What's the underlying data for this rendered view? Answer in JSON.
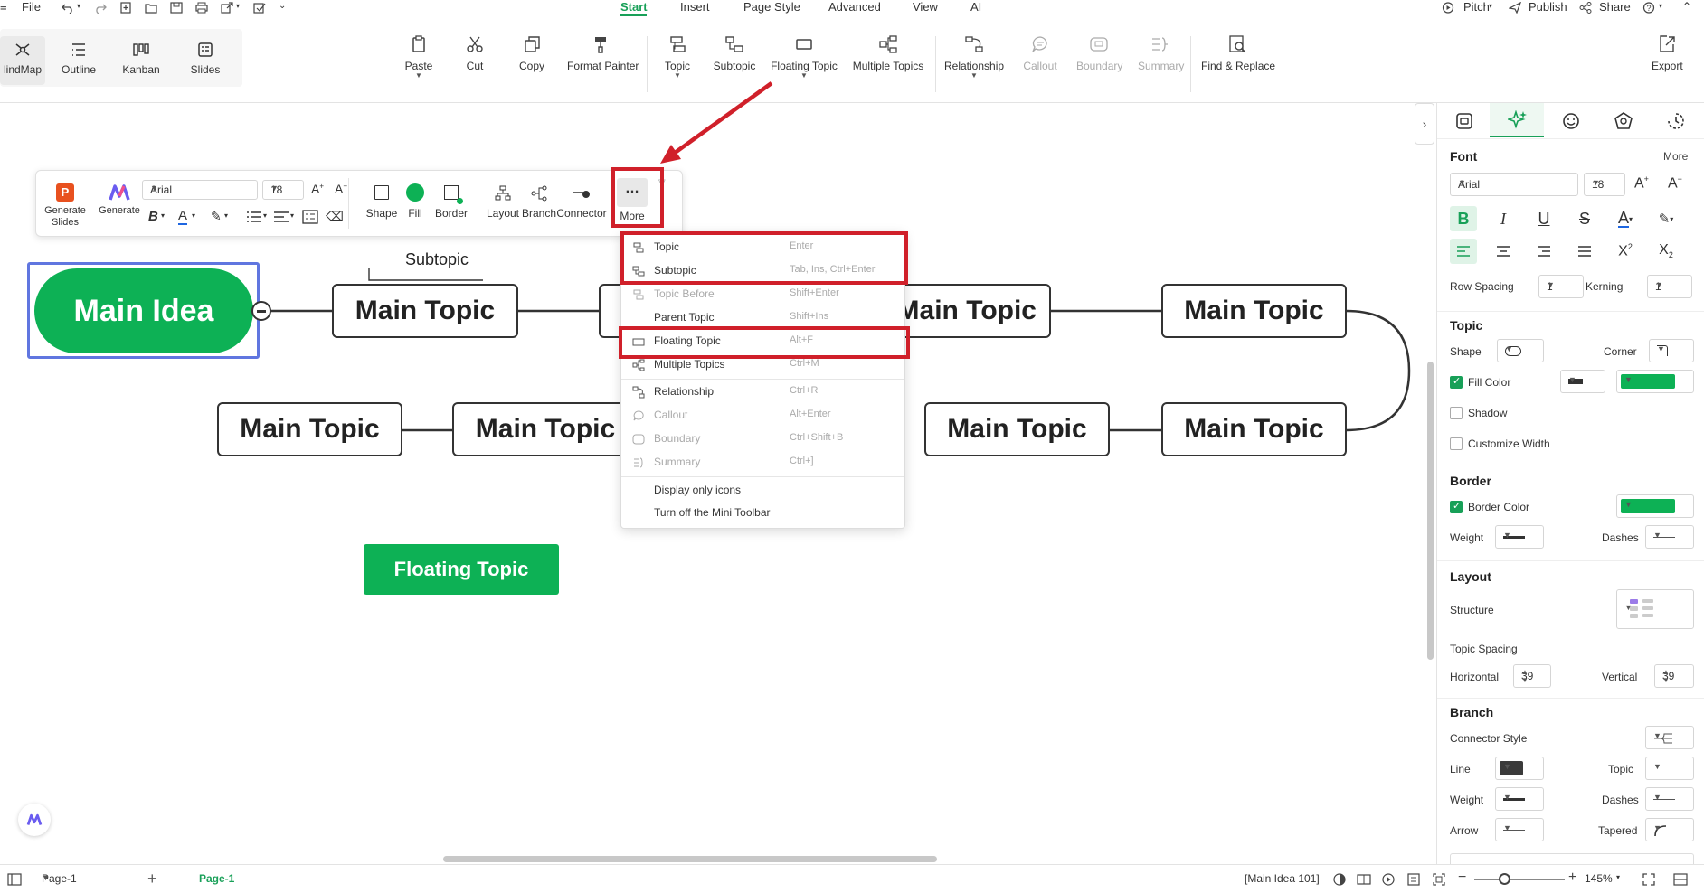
{
  "menubar": {
    "file": "File",
    "tabs": [
      "Start",
      "Insert",
      "Page Style",
      "Advanced",
      "View",
      "AI"
    ],
    "right": {
      "pitch": "Pitch",
      "publish": "Publish",
      "share": "Share"
    }
  },
  "views": [
    "lindMap",
    "Outline",
    "Kanban",
    "Slides"
  ],
  "ribbon": {
    "paste": "Paste",
    "cut": "Cut",
    "copy": "Copy",
    "format_painter": "Format Painter",
    "topic": "Topic",
    "subtopic": "Subtopic",
    "floating_topic": "Floating Topic",
    "multiple_topics": "Multiple Topics",
    "relationship": "Relationship",
    "callout": "Callout",
    "boundary": "Boundary",
    "summary": "Summary",
    "find_replace": "Find & Replace",
    "export": "Export"
  },
  "canvas": {
    "main_idea": "Main Idea",
    "subtopic_label": "Subtopic",
    "main_topic": "Main Topic",
    "floating_topic": "Floating Topic",
    "accent": "#0db155",
    "selection": "#6076e0",
    "annotation": "#d0202a"
  },
  "mini_toolbar": {
    "generate_slides": "Generate Slides",
    "generate": "Generate",
    "font": "Arial",
    "size": "18",
    "shape": "Shape",
    "fill": "Fill",
    "border": "Border",
    "layout": "Layout",
    "branch": "Branch",
    "connector": "Connector",
    "more": "More"
  },
  "more_menu": [
    {
      "label": "Topic",
      "shortcut": "Enter",
      "disabled": false
    },
    {
      "label": "Subtopic",
      "shortcut": "Tab, Ins, Ctrl+Enter",
      "disabled": false
    },
    {
      "label": "Topic Before",
      "shortcut": "Shift+Enter",
      "disabled": true
    },
    {
      "label": "Parent Topic",
      "shortcut": "Shift+Ins",
      "disabled": false
    },
    {
      "label": "Floating Topic",
      "shortcut": "Alt+F",
      "disabled": false
    },
    {
      "label": "Multiple Topics",
      "shortcut": "Ctrl+M",
      "disabled": false
    },
    {
      "label": "Relationship",
      "shortcut": "Ctrl+R",
      "disabled": false
    },
    {
      "label": "Callout",
      "shortcut": "Alt+Enter",
      "disabled": true
    },
    {
      "label": "Boundary",
      "shortcut": "Ctrl+Shift+B",
      "disabled": true
    },
    {
      "label": "Summary",
      "shortcut": "Ctrl+]",
      "disabled": true
    },
    {
      "label": "Display only icons",
      "shortcut": "",
      "disabled": false
    },
    {
      "label": "Turn off the Mini Toolbar",
      "shortcut": "",
      "disabled": false
    }
  ],
  "panel": {
    "font": {
      "title": "Font",
      "more": "More",
      "family": "Arial",
      "size": "18",
      "row_spacing": "Row Spacing",
      "row_spacing_val": "1",
      "kerning": "Kerning",
      "kerning_val": "1"
    },
    "topic": {
      "title": "Topic",
      "shape": "Shape",
      "corner": "Corner",
      "fill_color": "Fill Color",
      "shadow": "Shadow",
      "customize_width": "Customize Width"
    },
    "border": {
      "title": "Border",
      "border_color": "Border Color",
      "weight": "Weight",
      "dashes": "Dashes"
    },
    "layout": {
      "title": "Layout",
      "structure": "Structure",
      "topic_spacing": "Topic Spacing",
      "horizontal": "Horizontal",
      "horizontal_val": "39",
      "vertical": "Vertical",
      "vertical_val": "39"
    },
    "branch": {
      "title": "Branch",
      "connector_style": "Connector Style",
      "line": "Line",
      "topic": "Topic",
      "weight": "Weight",
      "dashes": "Dashes",
      "arrow": "Arrow",
      "tapered": "Tapered"
    }
  },
  "status": {
    "page_select": "Page-1",
    "page_tab": "Page-1",
    "selection": "[Main Idea 101]",
    "zoom": "145%"
  }
}
